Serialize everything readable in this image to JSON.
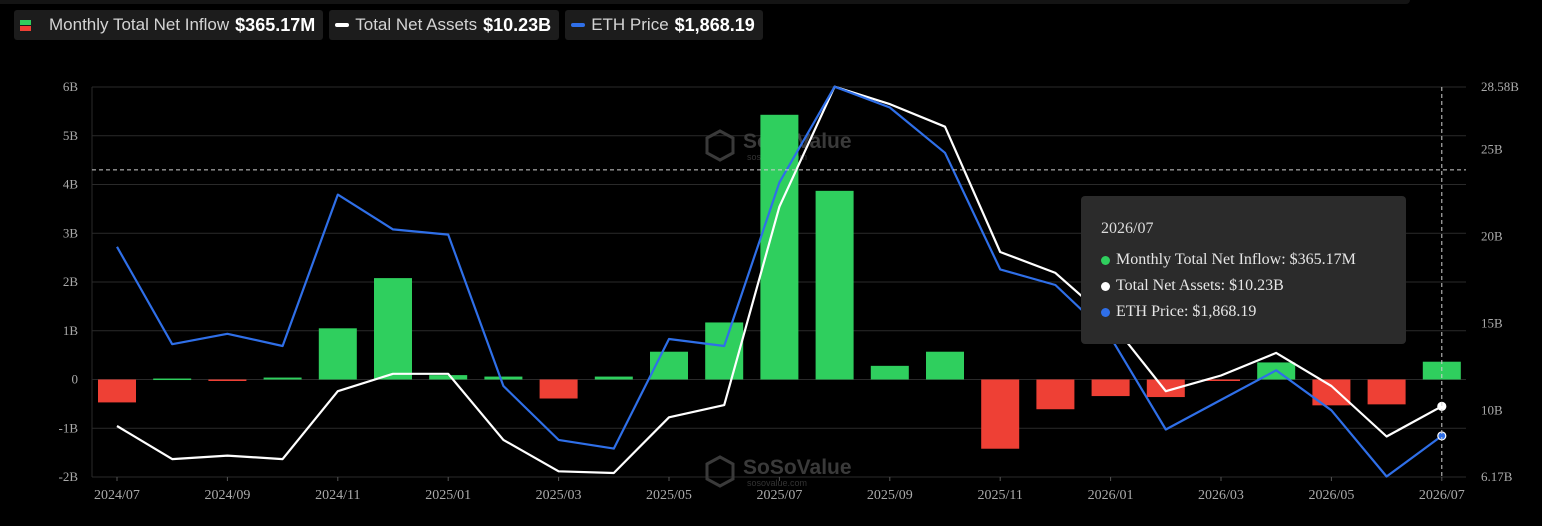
{
  "legend": [
    {
      "label": "Monthly Total Net Inflow",
      "value": "$365.17M",
      "icon": "bar-swatch-icon"
    },
    {
      "label": "Total Net Assets",
      "value": "$10.23B",
      "color": "#ffffff",
      "icon": "line-swatch-icon"
    },
    {
      "label": "ETH Price",
      "value": "$1,868.19",
      "color": "#2f6fe8",
      "icon": "line-swatch-icon"
    }
  ],
  "tooltip": {
    "title": "2026/07",
    "rows": [
      {
        "label": "Monthly Total Net Inflow: $365.17M",
        "color": "#2fcf5e"
      },
      {
        "label": "Total Net Assets: $10.23B",
        "color": "#ffffff"
      },
      {
        "label": "ETH Price: $1,868.19",
        "color": "#2f6fe8"
      }
    ]
  },
  "watermark": {
    "brand": "SoSoValue",
    "domain": "sosovalue.com"
  },
  "colors": {
    "positive": "#2fcf5e",
    "negative": "#ee4035",
    "assets": "#ffffff",
    "price": "#2f6fe8",
    "grid": "#2a2a2a"
  },
  "chart_data": {
    "type": "bar",
    "title": "",
    "grid": true,
    "categories": [
      "2024/07",
      "2024/08",
      "2024/09",
      "2024/10",
      "2024/11",
      "2024/12",
      "2025/01",
      "2025/02",
      "2025/03",
      "2025/04",
      "2025/05",
      "2025/06",
      "2025/07",
      "2025/08",
      "2025/09",
      "2025/10",
      "2025/11",
      "2025/12",
      "2026/01",
      "2026/02",
      "2026/03",
      "2026/04",
      "2026/05",
      "2026/06",
      "2026/07"
    ],
    "x_tick_labels": [
      "2024/07",
      "2024/09",
      "2024/11",
      "2025/01",
      "2025/03",
      "2025/05",
      "2025/07",
      "2025/09",
      "2025/11",
      "2026/01",
      "2026/03",
      "2026/05",
      "2026/07"
    ],
    "y_left": {
      "ylim": [
        -2,
        6
      ],
      "tick_labels": [
        "-2B",
        "-1B",
        "0",
        "1B",
        "2B",
        "3B",
        "4B",
        "5B",
        "6B"
      ],
      "ticks": [
        -2,
        -1,
        0,
        1,
        2,
        3,
        4,
        5,
        6
      ]
    },
    "y_right": {
      "ylim": [
        6.17,
        28.58
      ],
      "tick_labels": [
        "6.17B",
        "10B",
        "15B",
        "20B",
        "25B",
        "28.58B"
      ],
      "ticks": [
        6.17,
        10,
        15,
        20,
        25,
        28.58
      ]
    },
    "reference_line_left": 4.3,
    "series": [
      {
        "name": "Monthly Total Net Inflow",
        "kind": "bar",
        "axis": "left",
        "unit": "B USD",
        "values": [
          -0.47,
          0.02,
          -0.03,
          0.04,
          1.05,
          2.08,
          0.09,
          0.06,
          -0.39,
          0.06,
          0.57,
          1.17,
          5.43,
          3.87,
          0.28,
          0.57,
          -1.42,
          -0.61,
          -0.34,
          -0.36,
          -0.03,
          0.35,
          -0.53,
          -0.51,
          0.365
        ]
      },
      {
        "name": "Total Net Assets",
        "kind": "line",
        "axis": "right",
        "unit": "B USD",
        "values": [
          9.1,
          7.2,
          7.4,
          7.2,
          11.1,
          12.1,
          12.1,
          8.3,
          6.5,
          6.4,
          9.6,
          10.3,
          21.7,
          28.6,
          27.6,
          26.3,
          19.1,
          17.9,
          15.1,
          11.1,
          12.0,
          13.3,
          11.4,
          8.5,
          10.23
        ]
      },
      {
        "name": "ETH Price",
        "kind": "line",
        "axis": "right",
        "unit": "B-scaled",
        "values": [
          19.4,
          13.8,
          14.4,
          13.7,
          22.4,
          20.4,
          20.1,
          11.4,
          8.3,
          7.8,
          14.1,
          13.7,
          23.1,
          28.6,
          27.4,
          24.8,
          18.1,
          17.2,
          14.2,
          8.9,
          10.6,
          12.3,
          10.0,
          6.2,
          8.53
        ]
      }
    ]
  }
}
